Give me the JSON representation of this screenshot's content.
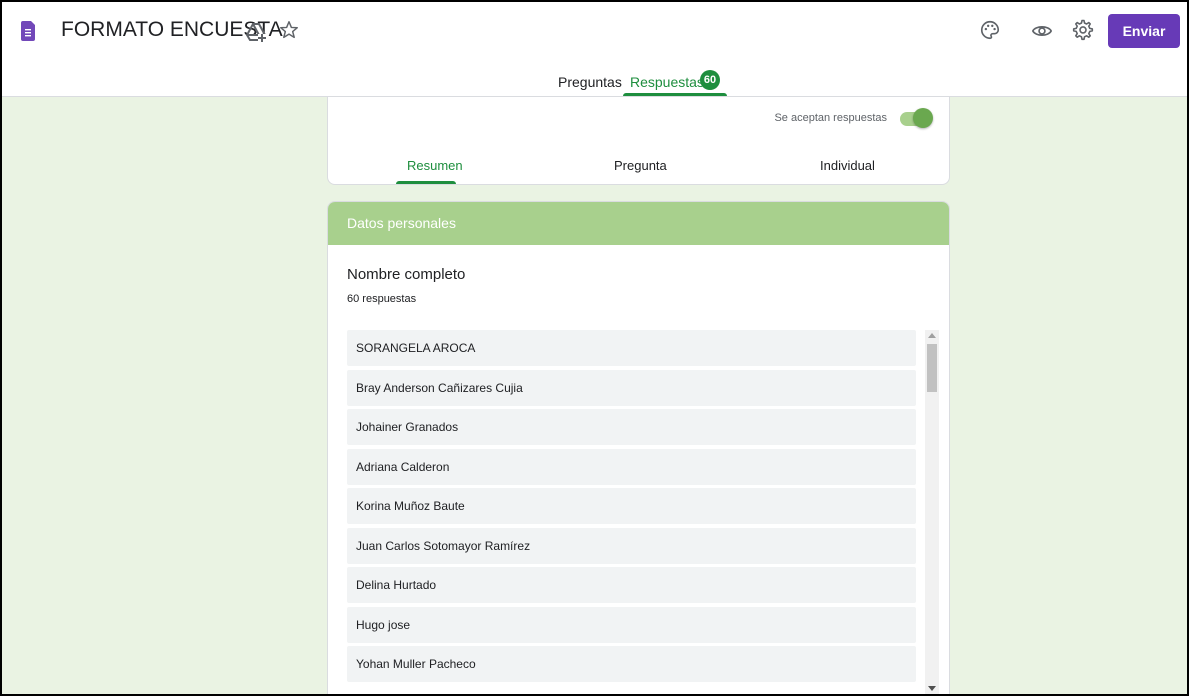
{
  "header": {
    "title": "FORMATO ENCUESTA",
    "send_label": "Enviar",
    "icons": [
      "forms-doc-icon",
      "move-to-drive-icon",
      "star-icon",
      "palette-icon",
      "preview-eye-icon",
      "settings-gear-icon"
    ]
  },
  "tabs": {
    "preguntas": "Preguntas",
    "respuestas": "Respuestas",
    "respuestas_count": "60"
  },
  "responses_panel": {
    "accepting_label": "Se aceptan respuestas",
    "accepting": true,
    "subtabs": [
      "Resumen",
      "Pregunta",
      "Individual"
    ]
  },
  "section": {
    "title": "Datos personales",
    "question": "Nombre completo",
    "answer_count": "60 respuestas",
    "answers": [
      "SORANGELA AROCA",
      "Bray Anderson Cañizares Cujia",
      "Johainer Granados",
      "Adriana Calderon",
      "Korina Muñoz Baute",
      "Juan Carlos Sotomayor Ramírez",
      "Delina Hurtado",
      "Hugo jose",
      "Yohan Muller Pacheco"
    ]
  },
  "colors": {
    "accent_purple": "#673ab7",
    "accent_green": "#1e8e3e",
    "section_header": "#a8d08d",
    "background": "#eaf3e3"
  }
}
